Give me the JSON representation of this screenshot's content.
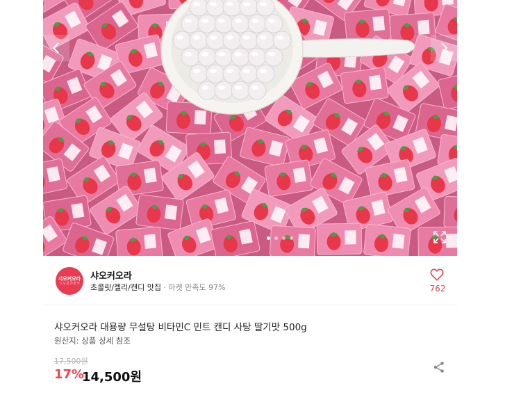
{
  "gallery": {
    "image_alt": "딸기맛 캔디",
    "slide_count": 4,
    "active_slide": 1,
    "left_icon": "chevron-left-icon",
    "right_icon": "chevron-right-icon",
    "expand_icon": "expand-icon"
  },
  "seller": {
    "logo_line1": "샤오커오라",
    "logo_line2": "シャオカオラ",
    "name": "샤오커오라",
    "category": "초콜릿/젤리/캔디 맛집",
    "separator": "·",
    "satisfaction": "마켓 만족도 97%",
    "like_count": "762",
    "heart_icon": "heart-icon"
  },
  "product": {
    "title": "샤오커오라 대용량 무설탕 비타민C 민트 캔디 사탕 딸기맛 500g",
    "origin": "원산지: 상품 상세 참조",
    "original_price": "17,500원",
    "discount": "17%",
    "price": "14,500원",
    "share_icon": "share-icon"
  },
  "colors": {
    "accent": "#f0434f",
    "candy_pink": "#e87aa2",
    "strawberry": "#e8364a"
  }
}
